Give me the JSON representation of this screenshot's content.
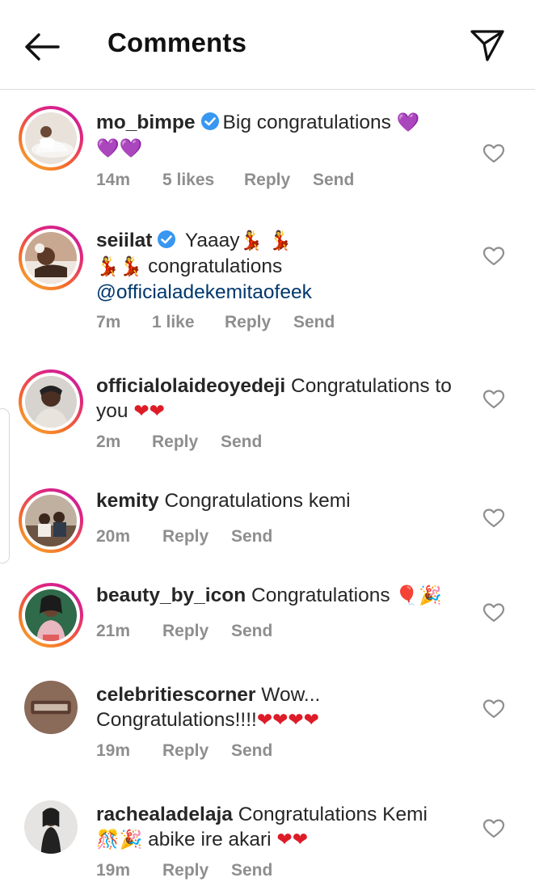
{
  "header": {
    "title": "Comments",
    "back_icon": "arrow-left-icon",
    "share_icon": "paper-plane-icon"
  },
  "colors": {
    "text": "#262626",
    "secondary": "#8e8e8e",
    "mention": "#00376b",
    "verified": "#3897f0"
  },
  "comments": [
    {
      "username": "mo_bimpe",
      "verified": true,
      "story_ring": true,
      "text_1": "Big congratulations ",
      "emoji_1": "💜",
      "text_2": "",
      "emoji_2": "💜💜",
      "time": "14m",
      "likes": "5 likes",
      "reply": "Reply",
      "send": "Send"
    },
    {
      "username": "seiilat",
      "verified": true,
      "story_ring": true,
      "text_1": "Yaaay",
      "emoji_1": "💃 💃",
      "emoji_2": "💃💃",
      "text_2": " congratulations",
      "mention": "@officialadekemitaofeek",
      "time": "7m",
      "likes": "1 like",
      "reply": "Reply",
      "send": "Send"
    },
    {
      "username": "officialolaideoyedeji",
      "verified": false,
      "story_ring": true,
      "text_1": "Congratulations to",
      "text_2": "you ",
      "emoji_2": "❤❤",
      "time": "2m",
      "reply": "Reply",
      "send": "Send"
    },
    {
      "username": "kemity",
      "verified": false,
      "story_ring": true,
      "text_1": "Congratulations kemi",
      "time": "20m",
      "reply": "Reply",
      "send": "Send"
    },
    {
      "username": "beauty_by_icon",
      "verified": false,
      "story_ring": true,
      "text_1": "Congratulations ",
      "emoji_1": "🎈🎉",
      "time": "21m",
      "reply": "Reply",
      "send": "Send"
    },
    {
      "username": "celebritiescorner",
      "verified": false,
      "story_ring": false,
      "text_1": "Wow...",
      "text_2": "Congratulations!!!!",
      "emoji_2": "❤❤❤❤",
      "time": "19m",
      "reply": "Reply",
      "send": "Send"
    },
    {
      "username": "rachealadelaja",
      "verified": false,
      "story_ring": false,
      "text_1": "Congratulations Kemi",
      "emoji_2": "🎊🎉",
      "text_2": " abike ire akari ",
      "emoji_3": "❤❤",
      "time": "19m",
      "reply": "Reply",
      "send": "Send"
    }
  ]
}
